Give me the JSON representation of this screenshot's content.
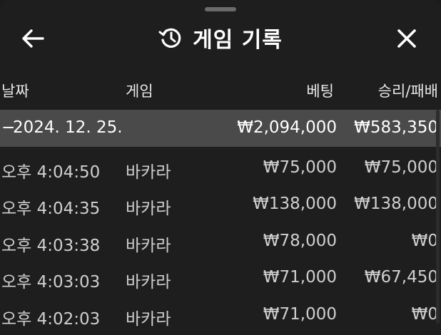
{
  "header": {
    "title": "게임 기록",
    "icons": {
      "back": "arrow-left-icon",
      "history": "history-icon",
      "close": "close-icon"
    }
  },
  "columns": {
    "date": "날짜",
    "game": "게임",
    "bet": "베팅",
    "result": "승리/패배"
  },
  "date_group": {
    "toggle": "−",
    "date": "2024. 12. 25.",
    "total_bet": "₩2,094,000",
    "total_result": "₩583,350"
  },
  "rows": [
    {
      "time": "오후 4:04:50",
      "game": "바카라",
      "bet": "₩75,000",
      "result": "₩75,000"
    },
    {
      "time": "오후 4:04:35",
      "game": "바카라",
      "bet": "₩138,000",
      "result": "₩138,000"
    },
    {
      "time": "오후 4:03:38",
      "game": "바카라",
      "bet": "₩78,000",
      "result": "₩0"
    },
    {
      "time": "오후 4:03:03",
      "game": "바카라",
      "bet": "₩71,000",
      "result": "₩67,450"
    },
    {
      "time": "오후 4:02:03",
      "game": "바카라",
      "bet": "₩71,000",
      "result": "₩0"
    }
  ]
}
